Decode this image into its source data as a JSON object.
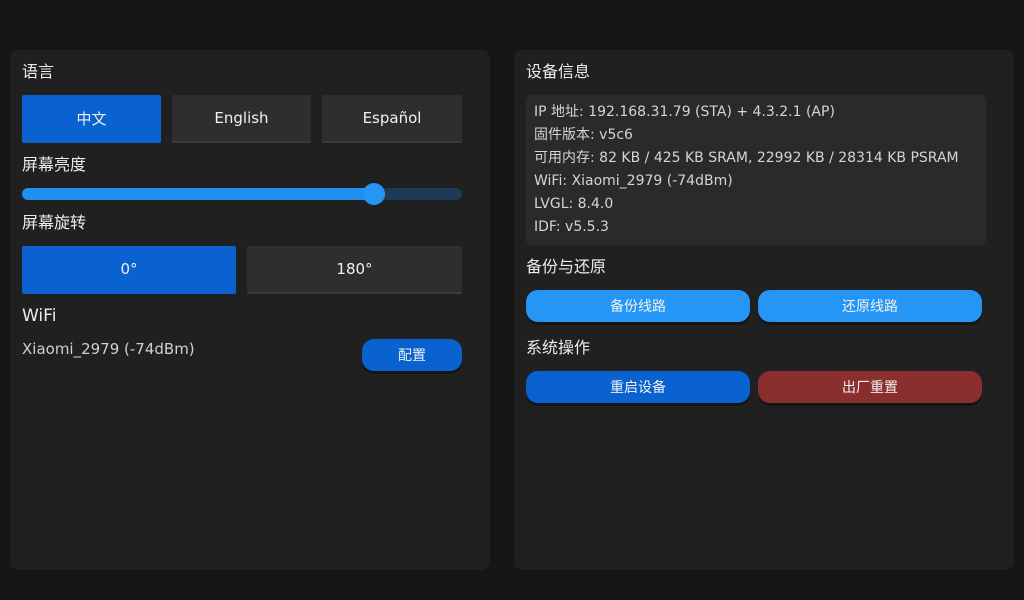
{
  "settings": {
    "language": {
      "title": "语言",
      "options": [
        "中文",
        "English",
        "Español"
      ],
      "selected": "中文"
    },
    "brightness": {
      "title": "屏幕亮度",
      "level_percent": 80
    },
    "rotation": {
      "title": "屏幕旋转",
      "options": [
        "0°",
        "180°"
      ],
      "selected": "0°"
    },
    "wifi": {
      "title": "WiFi",
      "ssid": "Xiaomi_2979 (-74dBm)",
      "config_label": "配置"
    }
  },
  "device_info": {
    "title": "设备信息",
    "lines": [
      "IP 地址: 192.168.31.79 (STA) + 4.3.2.1 (AP)",
      "固件版本: v5c6",
      "可用内存: 82 KB / 425 KB SRAM, 22992 KB / 28314 KB PSRAM",
      "WiFi: Xiaomi_2979 (-74dBm)",
      "LVGL: 8.4.0",
      "IDF: v5.5.3"
    ]
  },
  "backup": {
    "title": "备份与还原",
    "backup_label": "备份线路",
    "restore_label": "还原线路"
  },
  "system": {
    "title": "系统操作",
    "restart_label": "重启设备",
    "factory_reset_label": "出厂重置"
  },
  "colors": {
    "accent": "#0a62d0",
    "accent_light": "#2596f5",
    "danger": "#8b2e2e",
    "panel": "#202020",
    "background": "#161616"
  }
}
